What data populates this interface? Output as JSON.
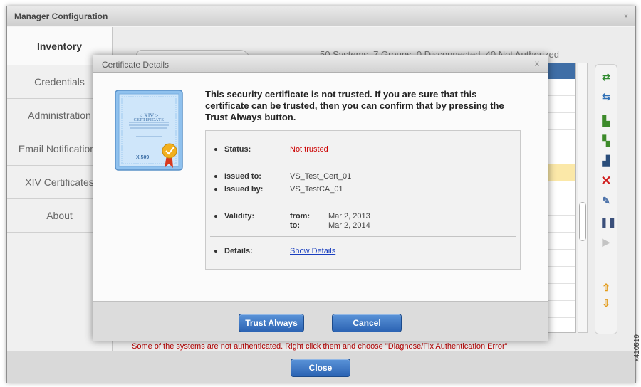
{
  "window": {
    "title": "Manager Configuration",
    "close_glyph": "x"
  },
  "sidebar": {
    "items": [
      {
        "label": "Inventory",
        "active": true
      },
      {
        "label": "Credentials"
      },
      {
        "label": "Administration"
      },
      {
        "label": "Email Notifications"
      },
      {
        "label": "XIV Certificates"
      },
      {
        "label": "About"
      }
    ]
  },
  "inventory": {
    "summary": "50 Systems, 7 Groups, 0 Disconnected, 40 Not Authorized",
    "warning": "Some of the systems are not authenticated. Right click them and choose \"Diagnose/Fix Authentication Error\"",
    "toolbar_icons": [
      "sync-icon",
      "sync-alt-icon",
      "add-system-icon",
      "add-group-icon",
      "copy-icon",
      "delete-icon",
      "edit-icon",
      "pause-icon",
      "play-icon",
      "move-up-icon",
      "move-down-icon"
    ],
    "close_label": "Close"
  },
  "dialog": {
    "title": "Certificate Details",
    "close_glyph": "x",
    "message": "This security certificate is not trusted. If you are sure that this certificate can be trusted, then you can confirm that by pressing the Trust Always button.",
    "certificate_image": {
      "line1": "≤ XIV ≥",
      "line2": "CERTIFICATE",
      "line3": "X.509"
    },
    "status_label": "Status:",
    "status_value": "Not trusted",
    "issued_to_label": "Issued to:",
    "issued_to_value": "VS_Test_Cert_01",
    "issued_by_label": "Issued by:",
    "issued_by_value": "VS_TestCA_01",
    "validity_label": "Validity:",
    "from_label": "from:",
    "from_value": "Mar 2, 2013",
    "to_label": "to:",
    "to_value": "Mar 2, 2014",
    "details_label": "Details:",
    "details_link": "Show Details",
    "trust_label": "Trust Always",
    "cancel_label": "Cancel"
  },
  "figure_id": "x410519",
  "colors": {
    "accent_blue": "#2b63b3",
    "status_red": "#cc0000",
    "selected_row": "#fbe8a8"
  }
}
